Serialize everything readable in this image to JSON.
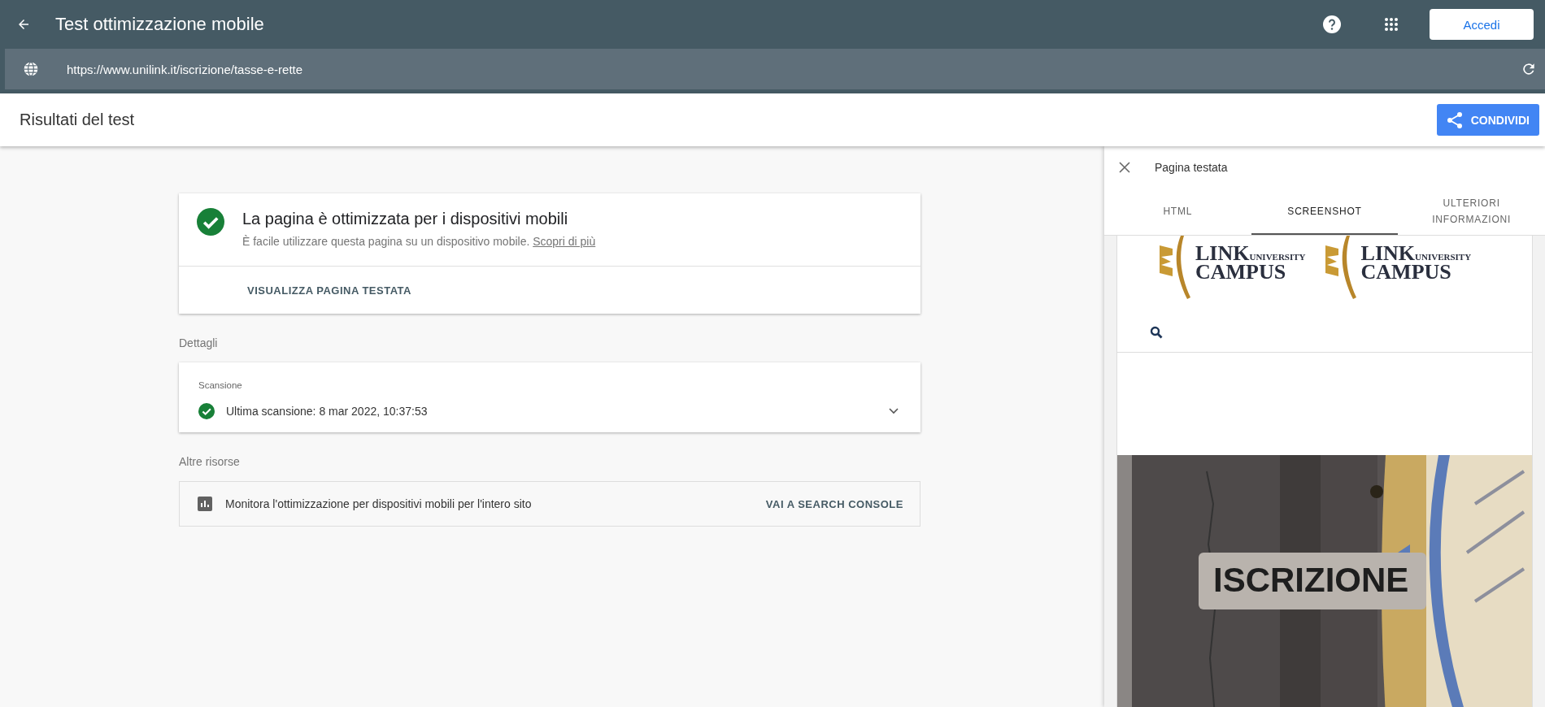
{
  "app_bar": {
    "title": "Test ottimizzazione mobile",
    "login_button": "Accedi"
  },
  "url_bar": {
    "value": "https://www.unilink.it/iscrizione/tasse-e-rette"
  },
  "header": {
    "title": "Risultati del test",
    "share_button": "CONDIVIDI"
  },
  "result": {
    "title": "La pagina è ottimizzata per i dispositivi mobili",
    "description": "È facile utilizzare questa pagina su un dispositivo mobile.",
    "link": "Scopri di più",
    "action": "VISUALIZZA PAGINA TESTATA"
  },
  "details": {
    "heading": "Dettagli",
    "section": "Scansione",
    "status": "Ultima scansione: 8 mar 2022, 10:37:53"
  },
  "resources": {
    "heading": "Altre risorse",
    "text": "Monitora l'ottimizzazione per dispositivi mobili per l'intero sito",
    "action": "VAI A SEARCH CONSOLE"
  },
  "panel": {
    "title": "Pagina testata",
    "tabs": [
      {
        "label": "HTML",
        "selected": false
      },
      {
        "label": "SCREENSHOT",
        "selected": true
      },
      {
        "label": "ULTERIORI INFORMAZIONI",
        "selected": false
      }
    ],
    "preview": {
      "logos": [
        {
          "line_1": "LINK",
          "line_2": "UNIVERSITY",
          "line_3": "CAMPUS"
        },
        {
          "line_1": "LINK",
          "line_2": "UNIVERSITY",
          "line_3": "CAMPUS"
        }
      ],
      "heading": "ISCRIZIONE"
    }
  }
}
